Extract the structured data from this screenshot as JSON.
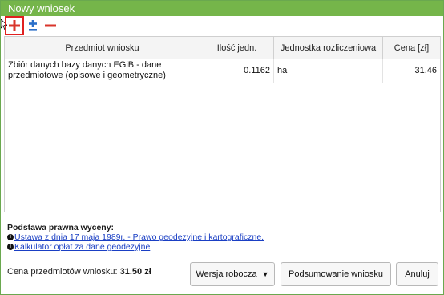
{
  "window": {
    "title": "Nowy wniosek"
  },
  "toolbar": {
    "add_icon": "plus-icon",
    "plusminus_icon": "plus-minus-icon",
    "remove_icon": "minus-icon",
    "colors": {
      "add": "#d9352b",
      "plusminus": "#2a6fc9",
      "remove": "#d9352b",
      "highlight": "#e02020"
    }
  },
  "table": {
    "headers": [
      "Przedmiot wniosku",
      "Ilość jedn.",
      "Jednostka rozliczeniowa",
      "Cena [zł]"
    ],
    "rows": [
      {
        "item": "Zbiór danych bazy danych EGiB - dane przedmiotowe (opisowe i geometryczne)",
        "quantity": "0.1162",
        "unit": "ha",
        "price": "31.46"
      }
    ]
  },
  "legal": {
    "title": "Podstawa prawna wyceny:",
    "link1": "Ustawa z dnia 17 maja 1989r. - Prawo geodezyjne i kartograficzne.",
    "link2": "Kalkulator opłat za dane geodezyjne"
  },
  "footer": {
    "total_label": "Cena przedmiotów wniosku:",
    "total_value": "31.50 zł",
    "draft_label": "Wersja robocza",
    "summary_label": "Podsumowanie wniosku",
    "cancel_label": "Anuluj"
  },
  "colors": {
    "titlebar": "#75b54a",
    "link": "#1a3fc4"
  }
}
